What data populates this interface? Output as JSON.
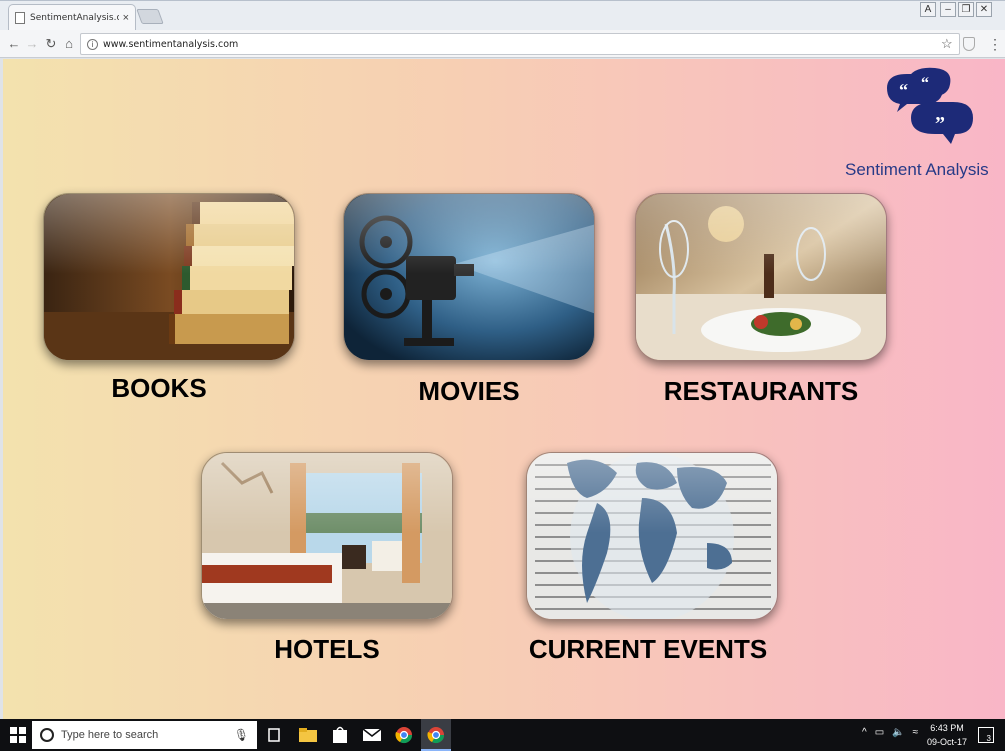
{
  "browser": {
    "tab_title": "SentimentAnalysis.com i",
    "tab_close": "×",
    "url": "www.sentimentanalysis.com",
    "info_symbol": "i",
    "star_icon": "star-icon",
    "menu_icon": "⋮"
  },
  "brand": {
    "name": "Sentiment Analysis",
    "color": "#273a87"
  },
  "categories": [
    {
      "label": "BOOKS",
      "icon": "books-image"
    },
    {
      "label": "MOVIES",
      "icon": "projector-image"
    },
    {
      "label": "RESTAURANTS",
      "icon": "restaurant-image"
    },
    {
      "label": "HOTELS",
      "icon": "hotel-room-image"
    },
    {
      "label": "CURRENT EVENTS",
      "icon": "world-news-image"
    }
  ],
  "taskbar": {
    "search_placeholder": "Type here to search",
    "time": "6:43 PM",
    "date": "09-Oct-17",
    "notifications": "3"
  },
  "colors": {
    "gradient_start": "#f3e2ae",
    "gradient_end": "#f9b6c7"
  }
}
